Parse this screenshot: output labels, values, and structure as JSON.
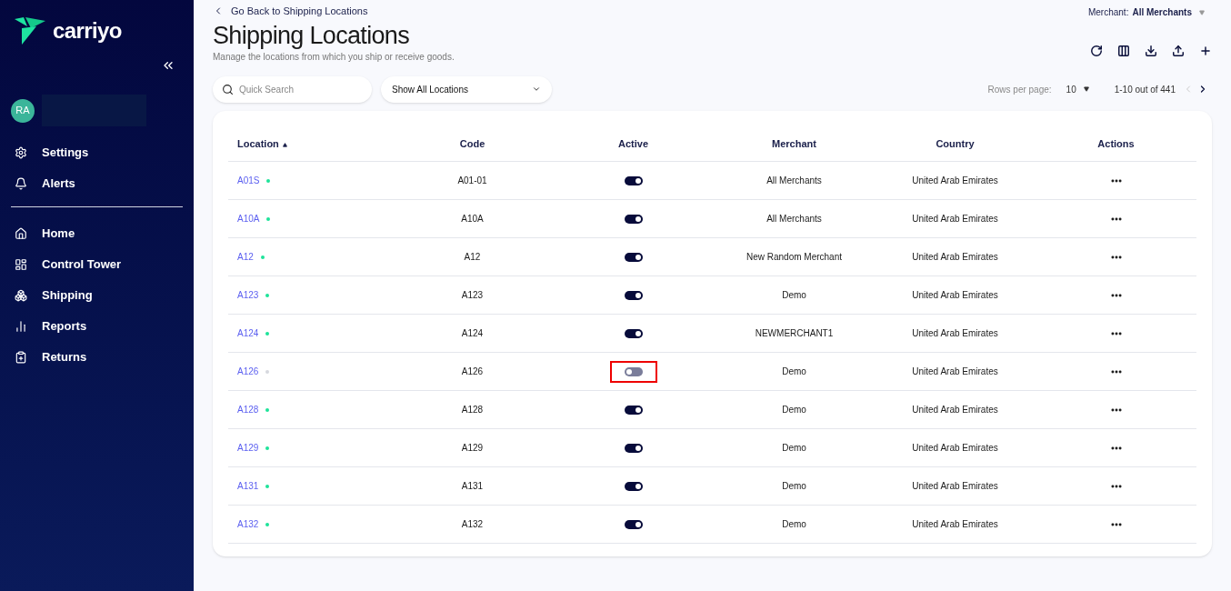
{
  "brand": {
    "name": "carriyo"
  },
  "user": {
    "initials": "RA"
  },
  "sidebar": {
    "groups": [
      [
        {
          "label": "Settings"
        },
        {
          "label": "Alerts"
        }
      ],
      [
        {
          "label": "Home"
        },
        {
          "label": "Control Tower"
        },
        {
          "label": "Shipping"
        },
        {
          "label": "Reports"
        },
        {
          "label": "Returns"
        }
      ]
    ]
  },
  "back_link": "Go Back to Shipping Locations",
  "title": "Shipping Locations",
  "subtitle": "Manage the locations from which you ship or receive goods.",
  "merchant_filter": {
    "label": "Merchant:",
    "value": "All Merchants"
  },
  "search": {
    "placeholder": "Quick Search"
  },
  "location_filter": {
    "value": "Show All Locations"
  },
  "pagination": {
    "rows_label": "Rows per page:",
    "rows_value": "10",
    "range": "1-10 out of 441",
    "prev_disabled": true
  },
  "table": {
    "columns": [
      "Location",
      "Code",
      "Active",
      "Merchant",
      "Country",
      "Actions"
    ],
    "rows": [
      {
        "location": "A01S",
        "code": "A01-01",
        "active": true,
        "merchant": "All Merchants",
        "country": "United Arab Emirates",
        "highlighted": false
      },
      {
        "location": "A10A",
        "code": "A10A",
        "active": true,
        "merchant": "All Merchants",
        "country": "United Arab Emirates",
        "highlighted": false
      },
      {
        "location": "A12",
        "code": "A12",
        "active": true,
        "merchant": "New Random Merchant",
        "country": "United Arab Emirates",
        "highlighted": false
      },
      {
        "location": "A123",
        "code": "A123",
        "active": true,
        "merchant": "Demo",
        "country": "United Arab Emirates",
        "highlighted": false
      },
      {
        "location": "A124",
        "code": "A124",
        "active": true,
        "merchant": "NEWMERCHANT1",
        "country": "United Arab Emirates",
        "highlighted": false
      },
      {
        "location": "A126",
        "code": "A126",
        "active": false,
        "merchant": "Demo",
        "country": "United Arab Emirates",
        "highlighted": true
      },
      {
        "location": "A128",
        "code": "A128",
        "active": true,
        "merchant": "Demo",
        "country": "United Arab Emirates",
        "highlighted": false
      },
      {
        "location": "A129",
        "code": "A129",
        "active": true,
        "merchant": "Demo",
        "country": "United Arab Emirates",
        "highlighted": false
      },
      {
        "location": "A131",
        "code": "A131",
        "active": true,
        "merchant": "Demo",
        "country": "United Arab Emirates",
        "highlighted": false
      },
      {
        "location": "A132",
        "code": "A132",
        "active": true,
        "merchant": "Demo",
        "country": "United Arab Emirates",
        "highlighted": false
      }
    ]
  }
}
